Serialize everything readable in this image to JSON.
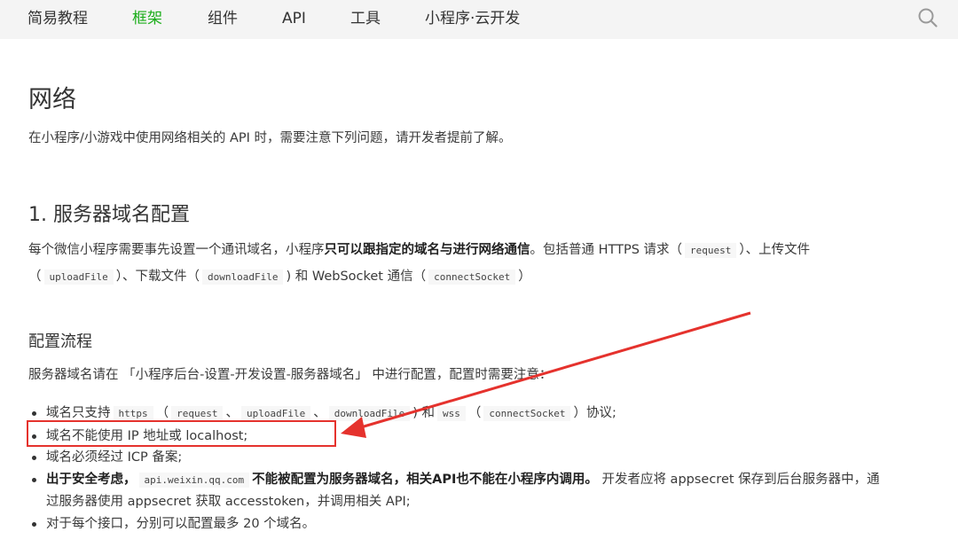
{
  "nav": {
    "items": [
      {
        "label": "简易教程"
      },
      {
        "label": "框架"
      },
      {
        "label": "组件"
      },
      {
        "label": "API"
      },
      {
        "label": "工具"
      },
      {
        "label": "小程序·云开发"
      }
    ],
    "active_color": "#1aad19"
  },
  "page": {
    "title": "网络",
    "intro": "在小程序/小游戏中使用网络相关的 API 时，需要注意下列问题，请开发者提前了解。",
    "section1": {
      "heading": "1. 服务器域名配置",
      "p1_a": "每个微信小程序需要事先设置一个通讯域名，小程序",
      "p1_bold": "只可以跟指定的域名与进行网络通信",
      "p1_b": "。包括普通 HTTPS 请求（",
      "code_request": "request",
      "p1_c": "）、上传文件",
      "p2_a": "（",
      "code_upload": "uploadFile",
      "p2_b": "）、下载文件（",
      "code_download": "downloadFile",
      "p2_c": ") 和 WebSocket 通信（",
      "code_socket": "connectSocket",
      "p2_d": "）"
    },
    "section_config": {
      "heading": "配置流程",
      "intro": "服务器域名请在 「小程序后台-设置-开发设置-服务器域名」 中进行配置，配置时需要注意：",
      "b1_a": "域名只支持",
      "b1_code_https": "https",
      "b1_b": "（",
      "b1_code_request": "request",
      "b1_c": "、",
      "b1_code_upload": "uploadFile",
      "b1_d": "、",
      "b1_code_download": "downloadFile",
      "b1_e": ") 和",
      "b1_code_wss": "wss",
      "b1_f": "（",
      "b1_code_socket": "connectSocket",
      "b1_g": "）协议;",
      "b2": "域名不能使用 IP 地址或 localhost;",
      "b3": "域名必须经过 ICP 备案;",
      "b4_bold1": "出于安全考虑，",
      "b4_code": "api.weixin.qq.com",
      "b4_bold2": "不能被配置为服务器域名，相关API也不能在小程序内调用。",
      "b4_a": " 开发者应将 appsecret 保存到后台服务器中，通",
      "b4_line2": "过服务器使用 appsecret 获取 accesstoken，并调用相关 API;",
      "b5": "对于每个接口，分别可以配置最多 20 个域名。"
    }
  },
  "annotation": {
    "color": "#e5322d"
  }
}
